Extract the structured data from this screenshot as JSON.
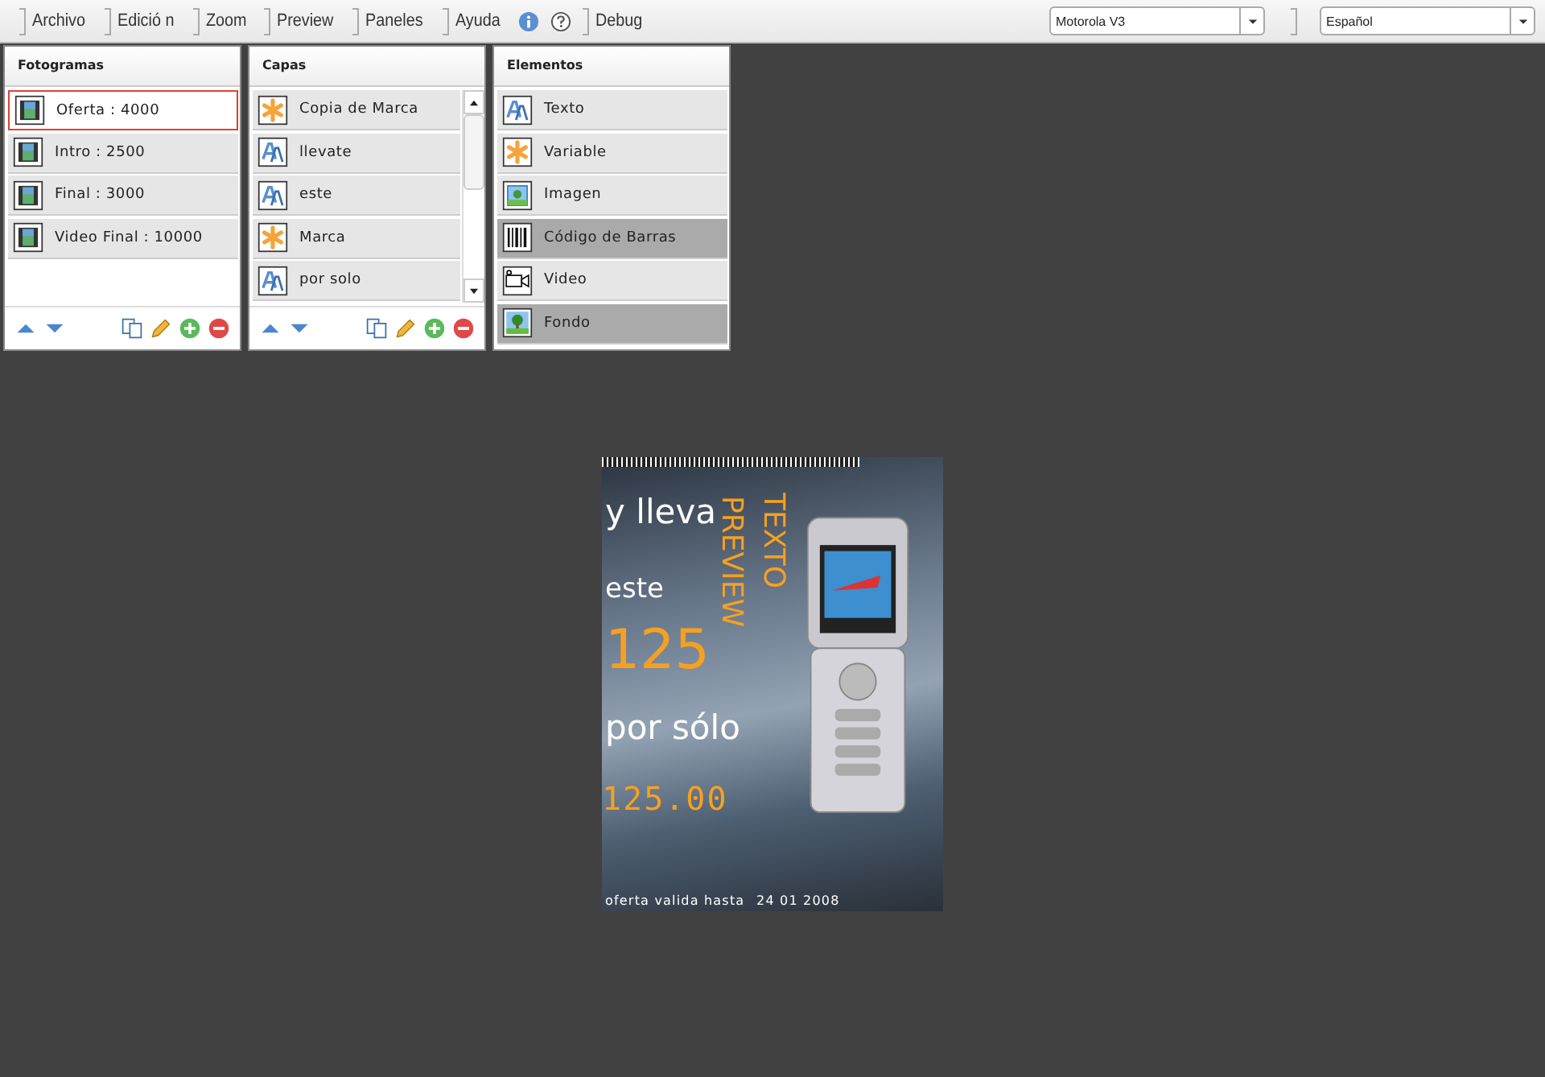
{
  "menu": [
    {
      "label": "Archivo",
      "kind": "plain"
    },
    {
      "label": "Edició n",
      "kind": "plain"
    },
    {
      "label": "Zoom",
      "kind": "plain"
    },
    {
      "label": "Preview",
      "kind": "plain"
    },
    {
      "label": "Paneles",
      "kind": "plain"
    },
    {
      "label": "Ayuda",
      "kind": "help"
    },
    {
      "label": "Debug",
      "kind": "plain"
    }
  ],
  "device_select": {
    "value": "Motorola V3"
  },
  "language_select": {
    "value": "Español"
  },
  "panels": [
    {
      "title": "Fotogramas",
      "scrollbar": false,
      "footer": true,
      "items": [
        {
          "label": "Oferta : 4000",
          "kind": "frame",
          "selected": true
        },
        {
          "label": "Intro : 2500",
          "kind": "frame",
          "selected": false
        },
        {
          "label": "Final : 3000",
          "kind": "frame",
          "selected": false
        },
        {
          "label": "Video Final : 10000",
          "kind": "frame",
          "selected": false
        }
      ]
    },
    {
      "title": "Capas",
      "scrollbar": true,
      "footer": true,
      "items": [
        {
          "label": "Copia de Marca",
          "kind": "variable",
          "selected": false
        },
        {
          "label": "llevate",
          "kind": "text",
          "selected": false
        },
        {
          "label": "este",
          "kind": "text",
          "selected": false
        },
        {
          "label": "Marca",
          "kind": "variable",
          "selected": false
        },
        {
          "label": "por solo",
          "kind": "text",
          "selected": false
        }
      ]
    },
    {
      "title": "Elementos",
      "scrollbar": false,
      "footer": false,
      "items": [
        {
          "label": "Texto",
          "kind": "text",
          "selected": false
        },
        {
          "label": "Variable",
          "kind": "variable",
          "selected": false
        },
        {
          "label": "Imagen",
          "kind": "image",
          "selected": false
        },
        {
          "label": "Código de Barras",
          "kind": "barcode",
          "selected": true
        },
        {
          "label": "Video",
          "kind": "video",
          "selected": false
        },
        {
          "label": "Fondo",
          "kind": "background",
          "selected": true
        }
      ]
    }
  ],
  "preview": {
    "texts": [
      {
        "text": "y lleva",
        "kind": "white-large"
      },
      {
        "text": "este",
        "kind": "white-medium"
      },
      {
        "text": "125",
        "kind": "orange-big"
      },
      {
        "text": "por sólo",
        "kind": "white-large"
      },
      {
        "text": "125.00",
        "kind": "orange-digital"
      }
    ],
    "vertical_texts": [
      "TEXTO",
      "PREVIEW"
    ],
    "footer": {
      "label": "oferta valida hasta",
      "date": "24 01 2008"
    }
  }
}
